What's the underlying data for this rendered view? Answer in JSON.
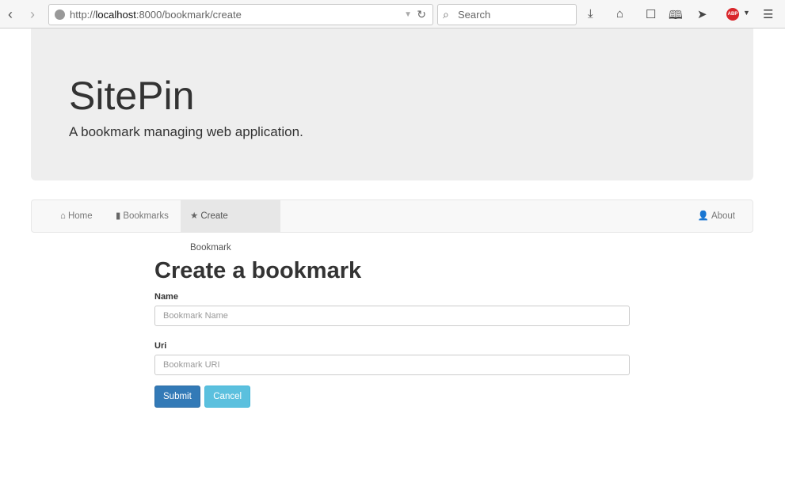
{
  "browser": {
    "url_prefix": "http://",
    "url_host": "localhost",
    "url_rest": ":8000/bookmark/create",
    "search_placeholder": "Search",
    "back_icon": "chevron-left",
    "forward_icon": "chevron-right",
    "abp_label": "ABP"
  },
  "jumbotron": {
    "title": "SitePin",
    "subtitle": "A bookmark managing web application."
  },
  "navbar": {
    "items": [
      {
        "label": "Home",
        "icon": "home"
      },
      {
        "label": "Bookmarks",
        "icon": "bookmark"
      },
      {
        "label": "Create Bookmark",
        "icon": "star",
        "active": true
      }
    ],
    "right": {
      "label": "About",
      "icon": "user"
    }
  },
  "form": {
    "title": "Create a bookmark",
    "name_label": "Name",
    "name_placeholder": "Bookmark Name",
    "name_value": "",
    "uri_label": "Uri",
    "uri_placeholder": "Bookmark URI",
    "uri_value": "",
    "submit": "Submit",
    "cancel": "Cancel"
  },
  "colors": {
    "primary": "#337ab7",
    "info": "#5bc0de",
    "jumbotron_bg": "#eeeeee"
  }
}
